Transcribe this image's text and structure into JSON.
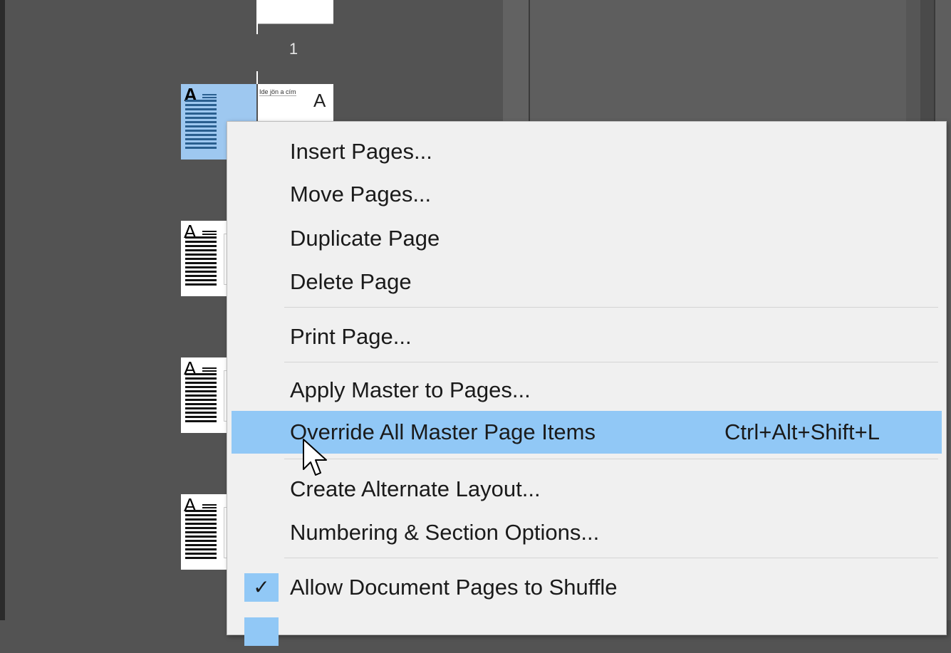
{
  "pages_panel": {
    "page_number": "1",
    "selected_thumb": {
      "letter": "A",
      "right_text": "Ide jön a cím",
      "right_letter": "A"
    },
    "thumbs": [
      {
        "letter": "A"
      },
      {
        "letter": "A"
      },
      {
        "letter": "A"
      }
    ]
  },
  "context_menu": {
    "items": [
      {
        "label": "Insert Pages..."
      },
      {
        "label": "Move Pages..."
      },
      {
        "label": "Duplicate Page"
      },
      {
        "label": "Delete Page"
      },
      {
        "label": "Print Page..."
      },
      {
        "label": "Apply Master to Pages..."
      },
      {
        "label": "Override All Master Page Items",
        "shortcut": "Ctrl+Alt+Shift+L",
        "highlighted": true
      },
      {
        "label": "Create Alternate Layout..."
      },
      {
        "label": "Numbering & Section Options..."
      },
      {
        "label": "Allow Document Pages to Shuffle",
        "checked": true,
        "check_glyph": "✓"
      }
    ]
  },
  "colors": {
    "highlight": "#91c8f6",
    "menu_bg": "#f0f0f0",
    "panel_bg": "#535353"
  },
  "icons": {
    "check": "checkmark-icon",
    "cursor": "arrow-cursor-icon"
  }
}
